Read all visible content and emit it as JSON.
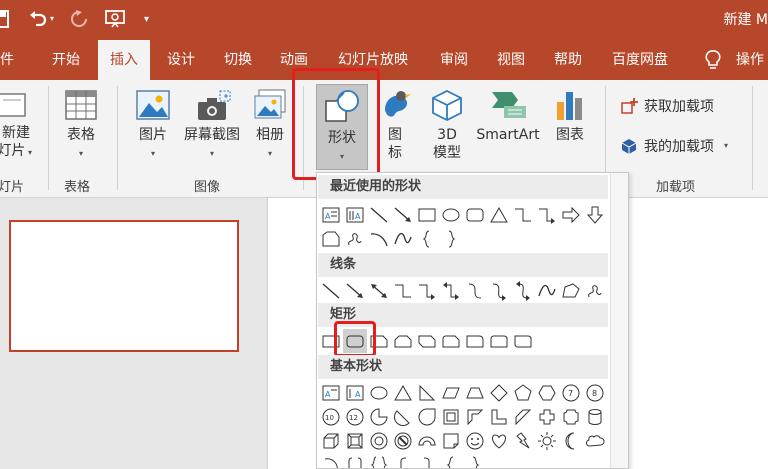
{
  "title_bar": {
    "undo_icon": "undo-icon",
    "redo_icon": "redo-icon",
    "present_icon": "present-from-start-icon",
    "customize_icon": "customize-qat-icon",
    "title": "新建 M"
  },
  "tabs": [
    "件",
    "开始",
    "插入",
    "设计",
    "切换",
    "动画",
    "幻灯片放映",
    "审阅",
    "视图",
    "帮助",
    "百度网盘",
    "操作"
  ],
  "active_tab": "插入",
  "ribbon": {
    "new_slide": {
      "line1": "新建",
      "line2": "灯片"
    },
    "table": "表格",
    "picture": "图片",
    "screenshot": "屏幕截图",
    "album": "相册",
    "shapes": "形状",
    "icons": {
      "line1": "图",
      "line2": "标"
    },
    "model3d": {
      "line1": "3D",
      "line2": "模型"
    },
    "smartart": "SmartArt",
    "chart": "图表",
    "get_addins": "获取加载项",
    "my_addins": "我的加载项",
    "groups": {
      "slides": "灯片",
      "table": "表格",
      "images": "图像",
      "addins": "加载项"
    }
  },
  "shapes_menu": {
    "recent": "最近使用的形状",
    "lines": "线条",
    "rectangles": "矩形",
    "basic": "基本形状"
  },
  "colors": {
    "accent": "#b7472a",
    "highlight": "#e21f1f"
  }
}
